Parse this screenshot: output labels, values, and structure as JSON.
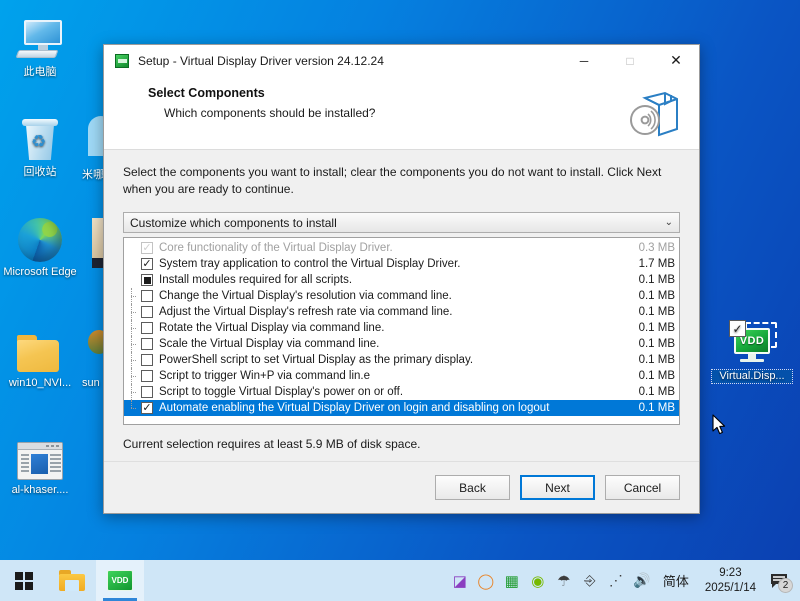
{
  "desktop": {
    "icons": [
      {
        "label": "此电脑",
        "icon": "my-computer-icon"
      },
      {
        "label": "回收站",
        "icon": "recycle-bin-icon"
      },
      {
        "label": "Microsoft Edge",
        "icon": "microsoft-edge-icon"
      },
      {
        "label": "win10_NVI...",
        "icon": "folder-icon"
      },
      {
        "label": "al-khaser....",
        "icon": "application-window-icon"
      },
      {
        "label": "Virtual.Disp...",
        "icon": "virtual-display-driver-icon"
      }
    ],
    "occluded": [
      {
        "label": "米哪"
      },
      {
        "label": "sun"
      }
    ]
  },
  "window": {
    "title": "Setup - Virtual Display Driver version 24.12.24",
    "icon": "vdd-setup-icon",
    "controls": {
      "minimize": "─",
      "maximize": "□",
      "close": "✕"
    },
    "header": {
      "title": "Select Components",
      "subtitle": "Which components should be installed?",
      "banner_icon": "setup-box-cd-icon"
    },
    "description": "Select the components you want to install; clear the components you do not want to install. Click Next when you are ready to continue.",
    "combo": {
      "value": "Customize which components to install",
      "chevron": "⌄",
      "icon": "chevron-down-icon"
    },
    "components": [
      {
        "label": "Core functionality of the Virtual Display Driver.",
        "size": "0.3 MB",
        "state": "checked-disabled",
        "level": 0,
        "selected": false
      },
      {
        "label": "System tray application to control the Virtual Display Driver.",
        "size": "1.7 MB",
        "state": "checked",
        "level": 0,
        "selected": false
      },
      {
        "label": "Install modules required for all scripts.",
        "size": "0.1 MB",
        "state": "partial",
        "level": 0,
        "selected": false
      },
      {
        "label": "Change the Virtual Display's resolution via command line.",
        "size": "0.1 MB",
        "state": "unchecked",
        "level": 1,
        "selected": false
      },
      {
        "label": "Adjust the Virtual Display's refresh rate via command line.",
        "size": "0.1 MB",
        "state": "unchecked",
        "level": 1,
        "selected": false
      },
      {
        "label": "Rotate the Virtual Display via command line.",
        "size": "0.1 MB",
        "state": "unchecked",
        "level": 1,
        "selected": false
      },
      {
        "label": "Scale the Virtual Display via command line.",
        "size": "0.1 MB",
        "state": "unchecked",
        "level": 1,
        "selected": false
      },
      {
        "label": "PowerShell script to set Virtual Display as the primary display.",
        "size": "0.1 MB",
        "state": "unchecked",
        "level": 1,
        "selected": false
      },
      {
        "label": "Script to trigger Win+P via command lin.e",
        "size": "0.1 MB",
        "state": "unchecked",
        "level": 1,
        "selected": false
      },
      {
        "label": "Script to toggle Virtual Display's power on or off.",
        "size": "0.1 MB",
        "state": "unchecked",
        "level": 1,
        "selected": false
      },
      {
        "label": "Automate enabling the Virtual Display Driver on login and disabling on logout",
        "size": "0.1 MB",
        "state": "checked",
        "level": 1,
        "selected": true
      }
    ],
    "disk_space": "Current selection requires at least 5.9 MB of disk space.",
    "buttons": {
      "back": "Back",
      "next": "Next",
      "cancel": "Cancel"
    }
  },
  "taskbar": {
    "start_icon": "windows-start-icon",
    "items": [
      {
        "name": "file-explorer",
        "icon": "folder-icon"
      },
      {
        "name": "vdd-setup",
        "icon": "vdd-icon",
        "active": true
      }
    ],
    "tray": [
      {
        "name": "onedrive-like-icon",
        "glyph": "◩"
      },
      {
        "name": "ring-icon",
        "glyph": "○"
      },
      {
        "name": "list-app-icon",
        "glyph": "≡"
      },
      {
        "name": "nvidia-icon",
        "glyph": "◉"
      },
      {
        "name": "security-warning-icon",
        "glyph": "⛨"
      },
      {
        "name": "safely-remove-hardware-icon",
        "glyph": "⎙"
      },
      {
        "name": "network-icon",
        "glyph": "⌸"
      },
      {
        "name": "volume-icon",
        "glyph": "🔊"
      }
    ],
    "ime": "简体",
    "clock_time": "9:23",
    "clock_date": "2025/1/14",
    "notification_count": "2",
    "notification_icon": "action-center-icon"
  },
  "colors": {
    "accent": "#0078d7",
    "taskbar": "#cfe6f7",
    "vdd_green": "#16a83a"
  }
}
